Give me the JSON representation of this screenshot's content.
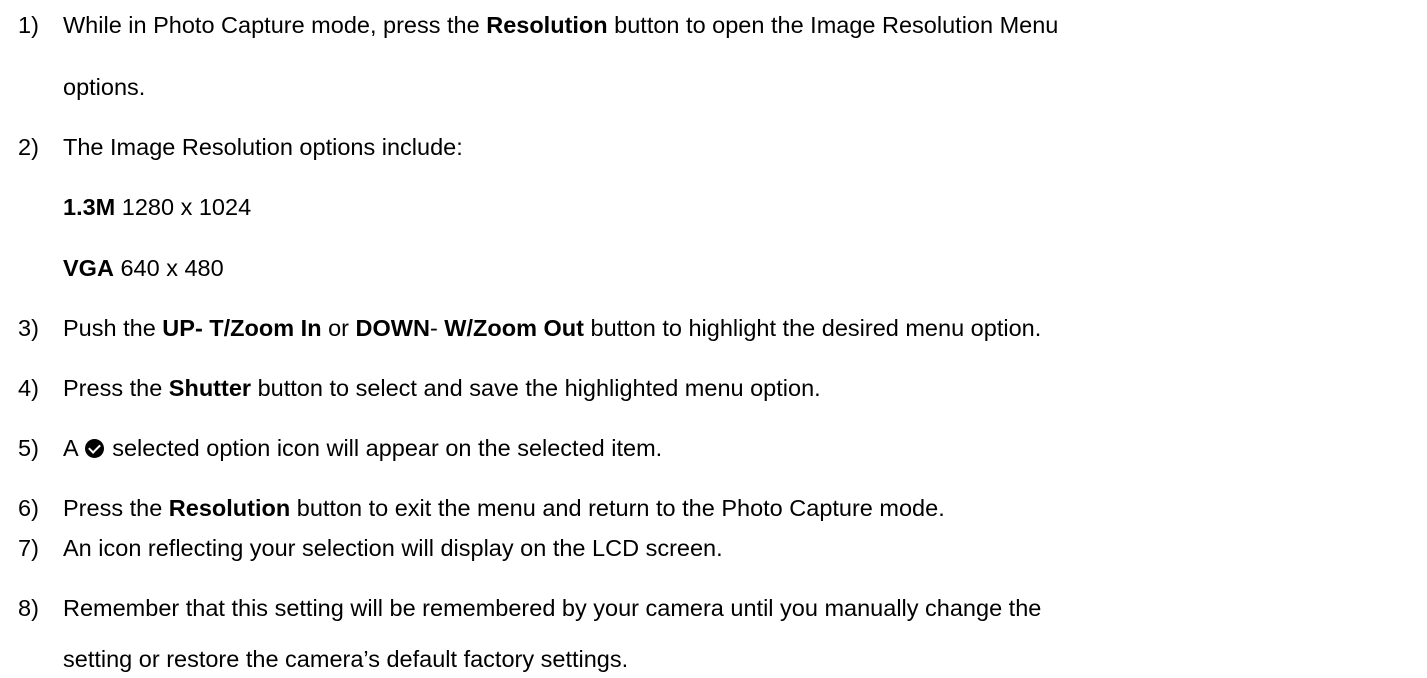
{
  "steps": [
    {
      "num": "1)",
      "pre": "While in Photo Capture mode, press the ",
      "bold": "Resolution",
      "post": " button to open the Image Resolution Menu",
      "cont": "options."
    },
    {
      "num": "2)",
      "text": "The Image Resolution options include:",
      "options": [
        {
          "label": "1.3M",
          "value": " 1280 x 1024"
        },
        {
          "label": "VGA",
          "value": " 640 x 480"
        }
      ]
    },
    {
      "num": "3)",
      "pre": "Push the ",
      "bold1": "UP- T/Zoom In",
      "mid1": " or ",
      "bold2": "DOWN",
      "mid2": "- ",
      "bold3": "W/Zoom Out",
      "post": " button to highlight the desired menu option."
    },
    {
      "num": "4)",
      "pre": "Press the ",
      "bold": "Shutter",
      "post": " button to select and save the highlighted menu option."
    },
    {
      "num": "5)",
      "pre": "A",
      "icon": "check-circle-icon",
      "post": " selected option icon will appear on the selected item."
    },
    {
      "num": "6)",
      "pre": "Press the ",
      "bold": "Resolution",
      "post": " button to exit the menu and return to the Photo Capture mode."
    },
    {
      "num": "7)",
      "text": "An icon reflecting your selection will display on the LCD screen."
    },
    {
      "num": "8)",
      "text": "Remember that this setting will be remembered by your camera until you manually change the",
      "cont": "setting or restore the camera’s default factory settings."
    }
  ]
}
